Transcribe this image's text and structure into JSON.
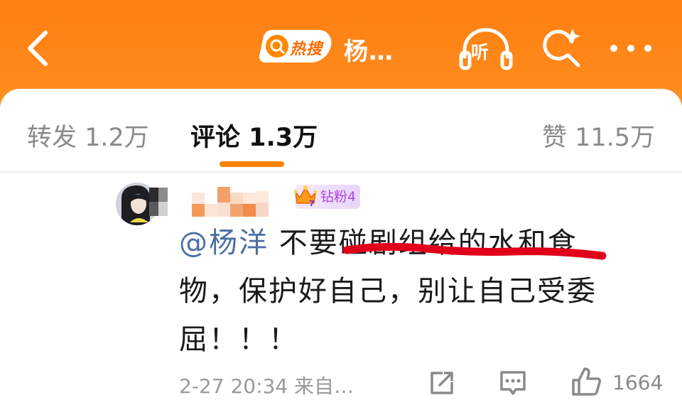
{
  "header": {
    "back_icon": "chevron-left-icon",
    "hot_search_label": "热搜",
    "topic_title": "杨…",
    "listen_label": "听",
    "search_icon": "sparkle-search-icon",
    "more_icon": "more-dots-icon"
  },
  "tabs": [
    {
      "label": "转发 1.2万",
      "active": false
    },
    {
      "label": "评论 1.3万",
      "active": true
    },
    {
      "label": "赞 11.5万",
      "active": false
    }
  ],
  "comment": {
    "badge_label": "钻粉4",
    "badge_level": "7",
    "mention": "@杨洋",
    "text_part1": " 不要碰剧组给的水和食",
    "text_part2": "物，保护好自己，别让自己受委",
    "text_part3": "屈！！！",
    "time": "2-27 20:34",
    "source": "来自…",
    "like_count": "1664"
  },
  "colors": {
    "header_orange": "#ff7f11",
    "tab_underline": "#ff8200",
    "mention_blue": "#4a6fa5",
    "marker_red": "#e0001b"
  }
}
